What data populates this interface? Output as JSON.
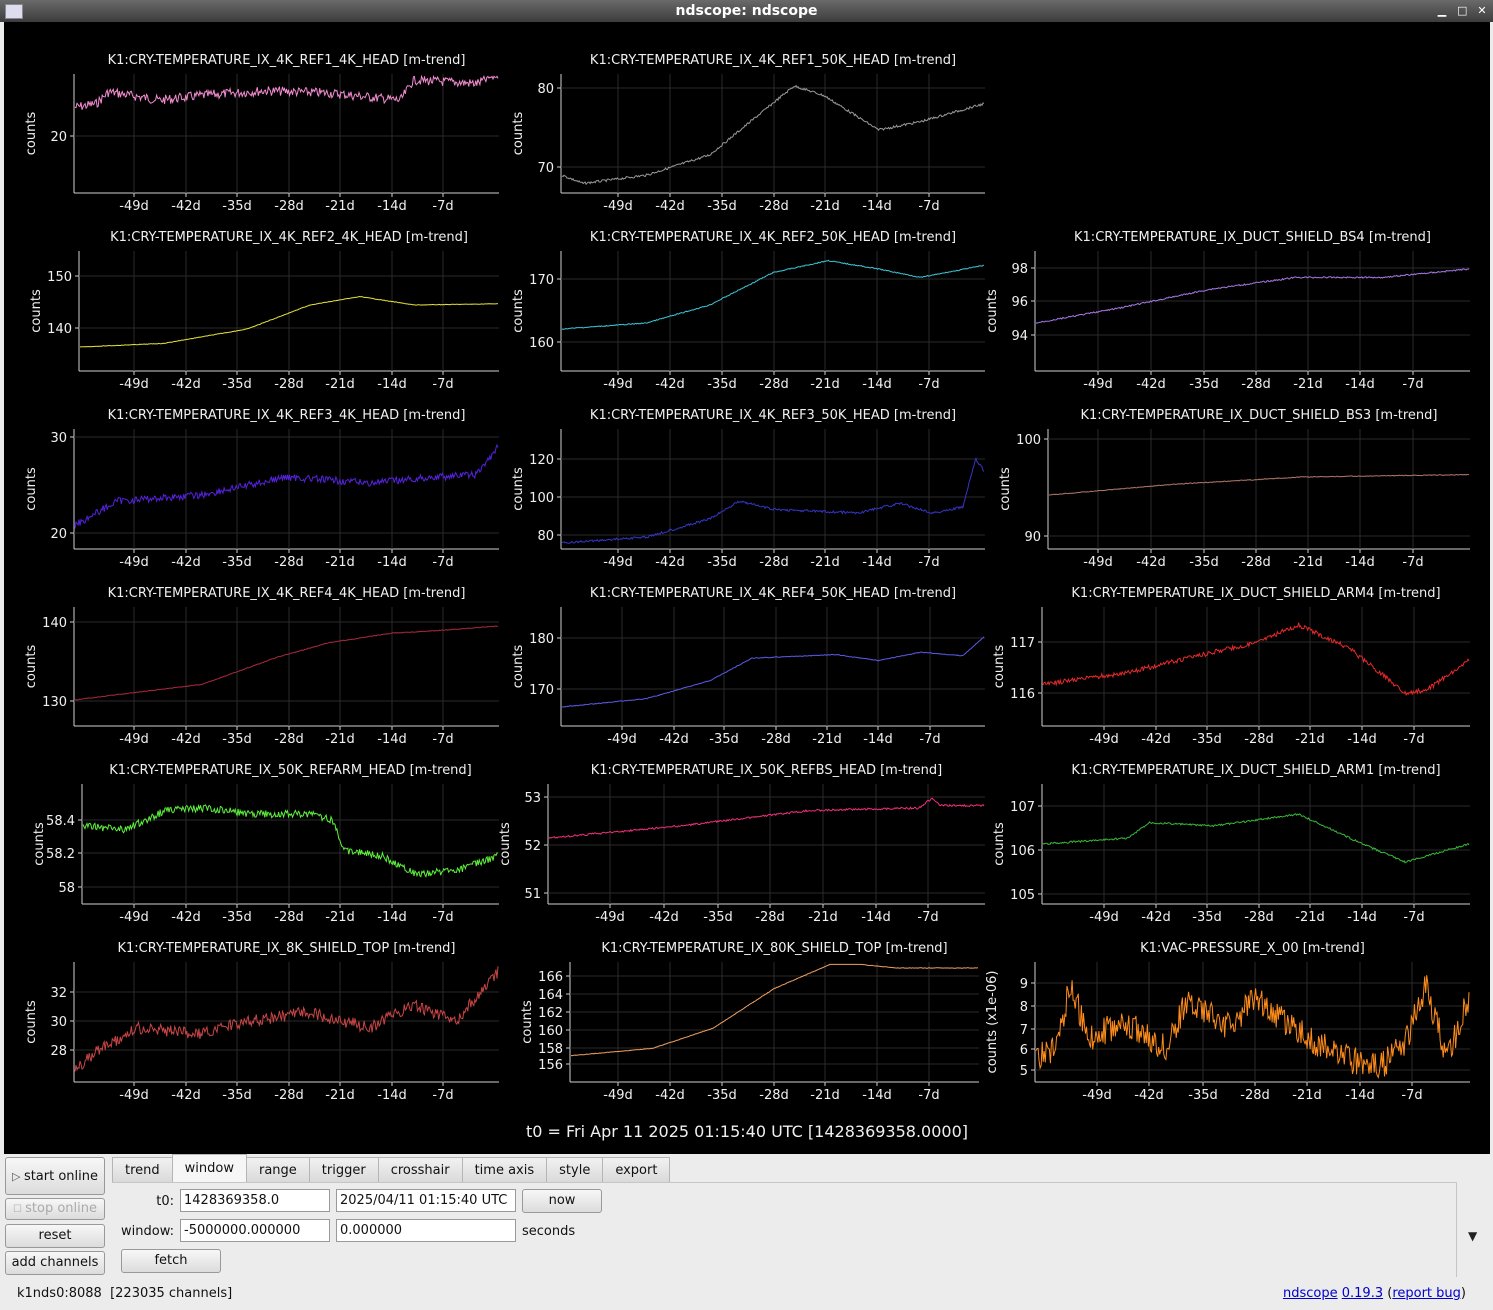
{
  "window": {
    "title": "ndscope: ndscope"
  },
  "plots": [
    {
      "title": "K1:CRY-TEMPERATURE_IX_4K_REF1_4K_HEAD [m-trend]",
      "ylabel": "counts",
      "yticks": [
        "20"
      ],
      "color": "#f28bd0",
      "xticks": [
        "-49d",
        "-42d",
        "-35d",
        "-28d",
        "-21d",
        "-14d",
        "-7d"
      ]
    },
    {
      "title": "K1:CRY-TEMPERATURE_IX_4K_REF1_50K_HEAD [m-trend]",
      "ylabel": "counts",
      "yticks": [
        "80",
        "70"
      ],
      "color": "#9a9a9a",
      "xticks": [
        "-49d",
        "-42d",
        "-35d",
        "-28d",
        "-21d",
        "-14d",
        "-7d"
      ]
    },
    null,
    {
      "title": "K1:CRY-TEMPERATURE_IX_4K_REF2_4K_HEAD [m-trend]",
      "ylabel": "counts",
      "yticks": [
        "150",
        "140"
      ],
      "color": "#e6e33a",
      "xticks": [
        "-49d",
        "-42d",
        "-35d",
        "-28d",
        "-21d",
        "-14d",
        "-7d"
      ]
    },
    {
      "title": "K1:CRY-TEMPERATURE_IX_4K_REF2_50K_HEAD [m-trend]",
      "ylabel": "counts",
      "yticks": [
        "170",
        "160"
      ],
      "color": "#3cc7d8",
      "xticks": [
        "-49d",
        "-42d",
        "-35d",
        "-28d",
        "-21d",
        "-14d",
        "-7d"
      ]
    },
    {
      "title": "K1:CRY-TEMPERATURE_IX_DUCT_SHIELD_BS4 [m-trend]",
      "ylabel": "counts",
      "yticks": [
        "98",
        "96",
        "94"
      ],
      "color": "#a679e6",
      "xticks": [
        "-49d",
        "-42d",
        "-35d",
        "-28d",
        "-21d",
        "-14d",
        "-7d"
      ]
    },
    {
      "title": "K1:CRY-TEMPERATURE_IX_4K_REF3_4K_HEAD [m-trend]",
      "ylabel": "counts",
      "yticks": [
        "30",
        "20"
      ],
      "color": "#5522dd",
      "xticks": [
        "-49d",
        "-42d",
        "-35d",
        "-28d",
        "-21d",
        "-14d",
        "-7d"
      ]
    },
    {
      "title": "K1:CRY-TEMPERATURE_IX_4K_REF3_50K_HEAD [m-trend]",
      "ylabel": "counts",
      "yticks": [
        "120",
        "100",
        "80"
      ],
      "color": "#3535c8",
      "xticks": [
        "-49d",
        "-42d",
        "-35d",
        "-28d",
        "-21d",
        "-14d",
        "-7d"
      ]
    },
    {
      "title": "K1:CRY-TEMPERATURE_IX_DUCT_SHIELD_BS3 [m-trend]",
      "ylabel": "counts",
      "yticks": [
        "100",
        "90"
      ],
      "color": "#b0786a",
      "xticks": [
        "-49d",
        "-42d",
        "-35d",
        "-28d",
        "-21d",
        "-14d",
        "-7d"
      ]
    },
    {
      "title": "K1:CRY-TEMPERATURE_IX_4K_REF4_4K_HEAD [m-trend]",
      "ylabel": "counts",
      "yticks": [
        "140",
        "130"
      ],
      "color": "#a82a3c",
      "xticks": [
        "-49d",
        "-42d",
        "-35d",
        "-28d",
        "-21d",
        "-14d",
        "-7d"
      ]
    },
    {
      "title": "K1:CRY-TEMPERATURE_IX_4K_REF4_50K_HEAD [m-trend]",
      "ylabel": "counts",
      "yticks": [
        "180",
        "170"
      ],
      "color": "#5b5be8",
      "xticks": [
        "-49d",
        "-42d",
        "-35d",
        "-28d",
        "-21d",
        "-14d",
        "-7d"
      ]
    },
    {
      "title": "K1:CRY-TEMPERATURE_IX_DUCT_SHIELD_ARM4 [m-trend]",
      "ylabel": "counts",
      "yticks": [
        "117",
        "116"
      ],
      "color": "#e62a2a",
      "xticks": [
        "-49d",
        "-42d",
        "-35d",
        "-28d",
        "-21d",
        "-14d",
        "-7d"
      ]
    },
    {
      "title": "K1:CRY-TEMPERATURE_IX_50K_REFARM_HEAD [m-trend]",
      "ylabel": "counts",
      "yticks": [
        "58.4",
        "58.2",
        "58"
      ],
      "color": "#5cf03c",
      "xticks": [
        "-49d",
        "-42d",
        "-35d",
        "-28d",
        "-21d",
        "-14d",
        "-7d"
      ]
    },
    {
      "title": "K1:CRY-TEMPERATURE_IX_50K_REFBS_HEAD [m-trend]",
      "ylabel": "counts",
      "yticks": [
        "53",
        "52",
        "51"
      ],
      "color": "#f0307a",
      "xticks": [
        "-49d",
        "-42d",
        "-35d",
        "-28d",
        "-21d",
        "-14d",
        "-7d"
      ]
    },
    {
      "title": "K1:CRY-TEMPERATURE_IX_DUCT_SHIELD_ARM1 [m-trend]",
      "ylabel": "counts",
      "yticks": [
        "107",
        "106",
        "105"
      ],
      "color": "#38b838",
      "xticks": [
        "-49d",
        "-42d",
        "-35d",
        "-28d",
        "-21d",
        "-14d",
        "-7d"
      ]
    },
    {
      "title": "K1:CRY-TEMPERATURE_IX_8K_SHIELD_TOP [m-trend]",
      "ylabel": "counts",
      "yticks": [
        "32",
        "30",
        "28"
      ],
      "color": "#c84545",
      "xticks": [
        "-49d",
        "-42d",
        "-35d",
        "-28d",
        "-21d",
        "-14d",
        "-7d"
      ]
    },
    {
      "title": "K1:CRY-TEMPERATURE_IX_80K_SHIELD_TOP [m-trend]",
      "ylabel": "counts",
      "yticks": [
        "166",
        "164",
        "162",
        "160",
        "158",
        "156"
      ],
      "color": "#f0a060",
      "xticks": [
        "-49d",
        "-42d",
        "-35d",
        "-28d",
        "-21d",
        "-14d",
        "-7d"
      ]
    },
    {
      "title": "K1:VAC-PRESSURE_X_00 [m-trend]",
      "ylabel": "counts (x1e-06)",
      "yticks": [
        "9",
        "8",
        "7",
        "6",
        "5"
      ],
      "color": "#ff8c1a",
      "xticks": [
        "-49d",
        "-42d",
        "-35d",
        "-28d",
        "-21d",
        "-14d",
        "-7d"
      ]
    }
  ],
  "t0_text": "t0 = Fri Apr 11 2025 01:15:40 UTC [1428369358.0000]",
  "side_buttons": {
    "start_online": "start online",
    "stop_online": "stop online",
    "reset": "reset",
    "add_channels": "add channels"
  },
  "tabs": [
    "trend",
    "window",
    "range",
    "trigger",
    "crosshair",
    "time axis",
    "style",
    "export"
  ],
  "window_tab": {
    "t0_label": "t0:",
    "t0_gps": "1428369358.0",
    "t0_utc": "2025/04/11 01:15:40 UTC",
    "now_label": "now",
    "window_label": "window:",
    "window_start": "-5000000.000000",
    "window_end": "0.000000",
    "seconds_label": "seconds",
    "fetch_label": "fetch"
  },
  "status": {
    "server": "k1nds0:8088",
    "channels": "[223035 channels]"
  },
  "about": {
    "app": "ndscope",
    "version": "0.19.3",
    "report": "report bug"
  }
}
